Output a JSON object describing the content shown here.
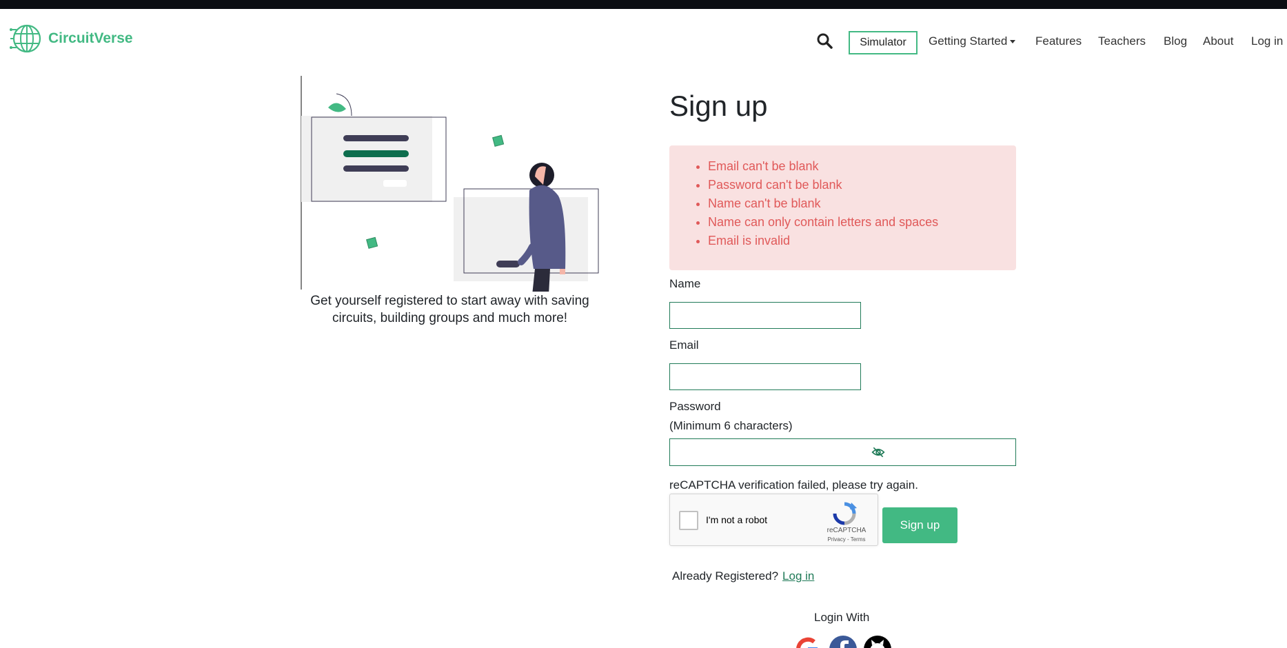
{
  "brand": {
    "name": "CircuitVerse",
    "color": "#42b983"
  },
  "nav": {
    "search_icon": "search-icon",
    "simulator": "Simulator",
    "getting_started": "Getting Started",
    "features": "Features",
    "teachers": "Teachers",
    "blog": "Blog",
    "about": "About",
    "login": "Log in"
  },
  "hero": {
    "tagline_line1": "Get yourself registered to start away with saving",
    "tagline_line2": "circuits, building groups and much more!"
  },
  "form": {
    "title": "Sign up",
    "errors": [
      "Email can't be blank",
      "Password can't be blank",
      "Name can't be blank",
      "Name can only contain letters and spaces",
      "Email is invalid"
    ],
    "name_label": "Name",
    "name_value": "",
    "email_label": "Email",
    "email_value": "",
    "password_label": "Password",
    "password_hint": "(Minimum 6 characters)",
    "password_value": "",
    "captcha_error": "reCAPTCHA verification failed, please try again.",
    "recaptcha": {
      "label": "I'm not a robot",
      "brand": "reCAPTCHA",
      "terms": "Privacy - Terms"
    },
    "submit": "Sign up",
    "already_text": "Already Registered?",
    "login_link": "Log in",
    "login_with": "Login With"
  },
  "colors": {
    "accent": "#42b983",
    "border": "#1f7a57",
    "error_bg": "#f9e1e1",
    "error_text": "#e05959"
  }
}
